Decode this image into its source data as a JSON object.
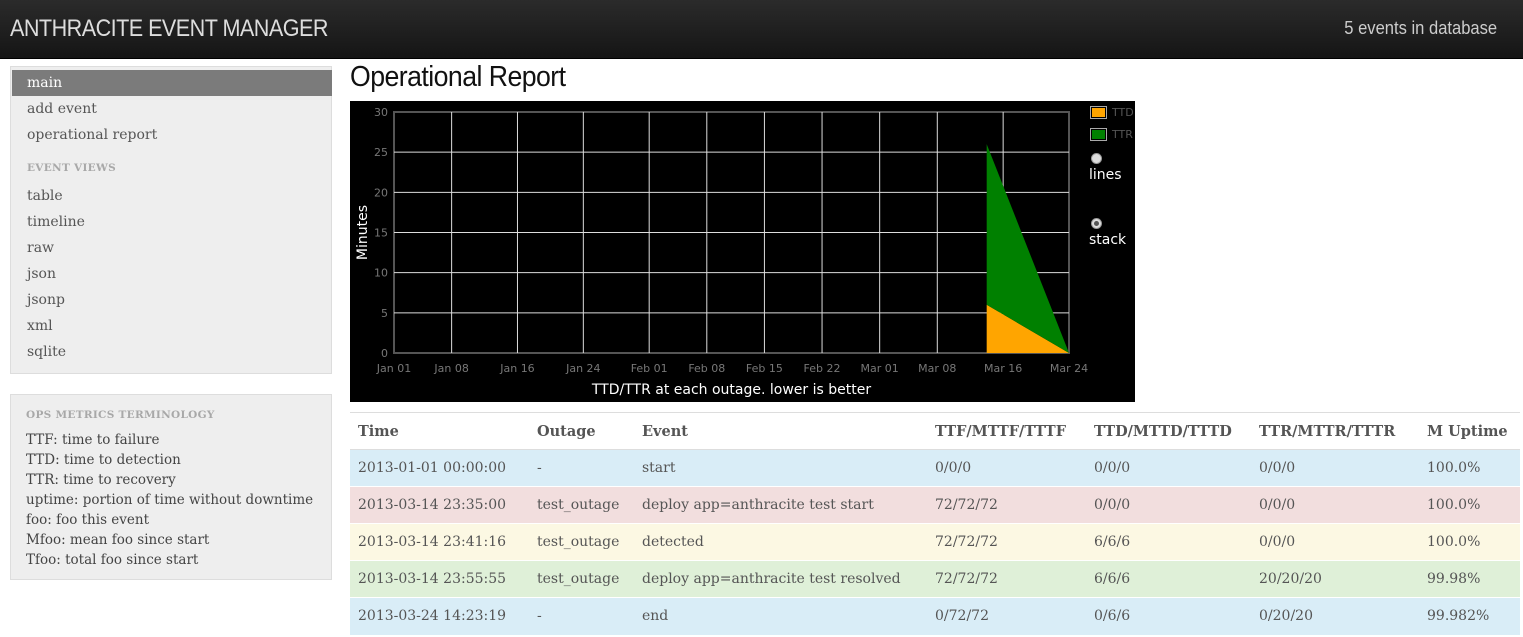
{
  "app": {
    "title": "ANTHRACITE EVENT MANAGER",
    "event_count": "5 events in database"
  },
  "sidebar": {
    "items": [
      {
        "label": "main",
        "active": true
      },
      {
        "label": "add event"
      },
      {
        "label": "operational report"
      }
    ],
    "views_header": "EVENT VIEWS",
    "views": [
      {
        "label": "table"
      },
      {
        "label": "timeline"
      },
      {
        "label": "raw"
      },
      {
        "label": "json"
      },
      {
        "label": "jsonp"
      },
      {
        "label": "xml"
      },
      {
        "label": "sqlite"
      }
    ],
    "terms_header": "OPS METRICS TERMINOLOGY",
    "terms": [
      "TTF: time to failure",
      "TTD: time to detection",
      "TTR: time to recovery",
      "uptime: portion of time without downtime",
      "foo: foo this event",
      "Mfoo: mean foo since start",
      "Tfoo: total foo since start"
    ]
  },
  "main": {
    "title": "Operational Report"
  },
  "chart_controls": {
    "modes": [
      {
        "label": "lines",
        "checked": false
      },
      {
        "label": "stack",
        "checked": true
      }
    ]
  },
  "chart_data": {
    "type": "area",
    "stacked": true,
    "background": "#000000",
    "grid": true,
    "xlabel": "TTD/TTR at each outage. lower is better",
    "ylabel": "Minutes",
    "ylim": [
      0,
      30
    ],
    "xlim": [
      "2013-01-01",
      "2013-03-24"
    ],
    "y_ticks": [
      0,
      5,
      10,
      15,
      20,
      25,
      30
    ],
    "x_ticks": [
      {
        "label": "Jan 01",
        "date": "2013-01-01"
      },
      {
        "label": "Jan 08",
        "date": "2013-01-08"
      },
      {
        "label": "Jan 16",
        "date": "2013-01-16"
      },
      {
        "label": "Jan 24",
        "date": "2013-01-24"
      },
      {
        "label": "Feb 01",
        "date": "2013-02-01"
      },
      {
        "label": "Feb 08",
        "date": "2013-02-08"
      },
      {
        "label": "Feb 15",
        "date": "2013-02-15"
      },
      {
        "label": "Feb 22",
        "date": "2013-02-22"
      },
      {
        "label": "Mar 01",
        "date": "2013-03-01"
      },
      {
        "label": "Mar 08",
        "date": "2013-03-08"
      },
      {
        "label": "Mar 16",
        "date": "2013-03-16"
      },
      {
        "label": "Mar 24",
        "date": "2013-03-24"
      }
    ],
    "legend_position": "right",
    "series": [
      {
        "name": "TTD",
        "color": "#FFA500",
        "points": [
          {
            "x": "2013-03-14",
            "y": 6
          },
          {
            "x": "2013-03-24",
            "y": 0
          }
        ]
      },
      {
        "name": "TTR",
        "color": "#008000",
        "points": [
          {
            "x": "2013-03-14",
            "y": 20
          },
          {
            "x": "2013-03-24",
            "y": 0
          }
        ]
      }
    ]
  },
  "table": {
    "headers": [
      "Time",
      "Outage",
      "Event",
      "TTF/MTTF/TTTF",
      "TTD/MTTD/TTTD",
      "TTR/MTTR/TTTR",
      "M Uptime"
    ],
    "rows": [
      {
        "status": "info",
        "cells": [
          "2013-01-01 00:00:00",
          "-",
          "start",
          "0/0/0",
          "0/0/0",
          "0/0/0",
          "100.0%"
        ]
      },
      {
        "status": "error",
        "cells": [
          "2013-03-14 23:35:00",
          "test_outage",
          "deploy app=anthracite test start",
          "72/72/72",
          "0/0/0",
          "0/0/0",
          "100.0%"
        ]
      },
      {
        "status": "warning",
        "cells": [
          "2013-03-14 23:41:16",
          "test_outage",
          "detected",
          "72/72/72",
          "6/6/6",
          "0/0/0",
          "100.0%"
        ]
      },
      {
        "status": "success",
        "cells": [
          "2013-03-14 23:55:55",
          "test_outage",
          "deploy app=anthracite test resolved",
          "72/72/72",
          "6/6/6",
          "20/20/20",
          "99.98%"
        ]
      },
      {
        "status": "info",
        "cells": [
          "2013-03-24 14:23:19",
          "-",
          "end",
          "0/72/72",
          "0/6/6",
          "0/20/20",
          "99.982%"
        ]
      }
    ]
  }
}
